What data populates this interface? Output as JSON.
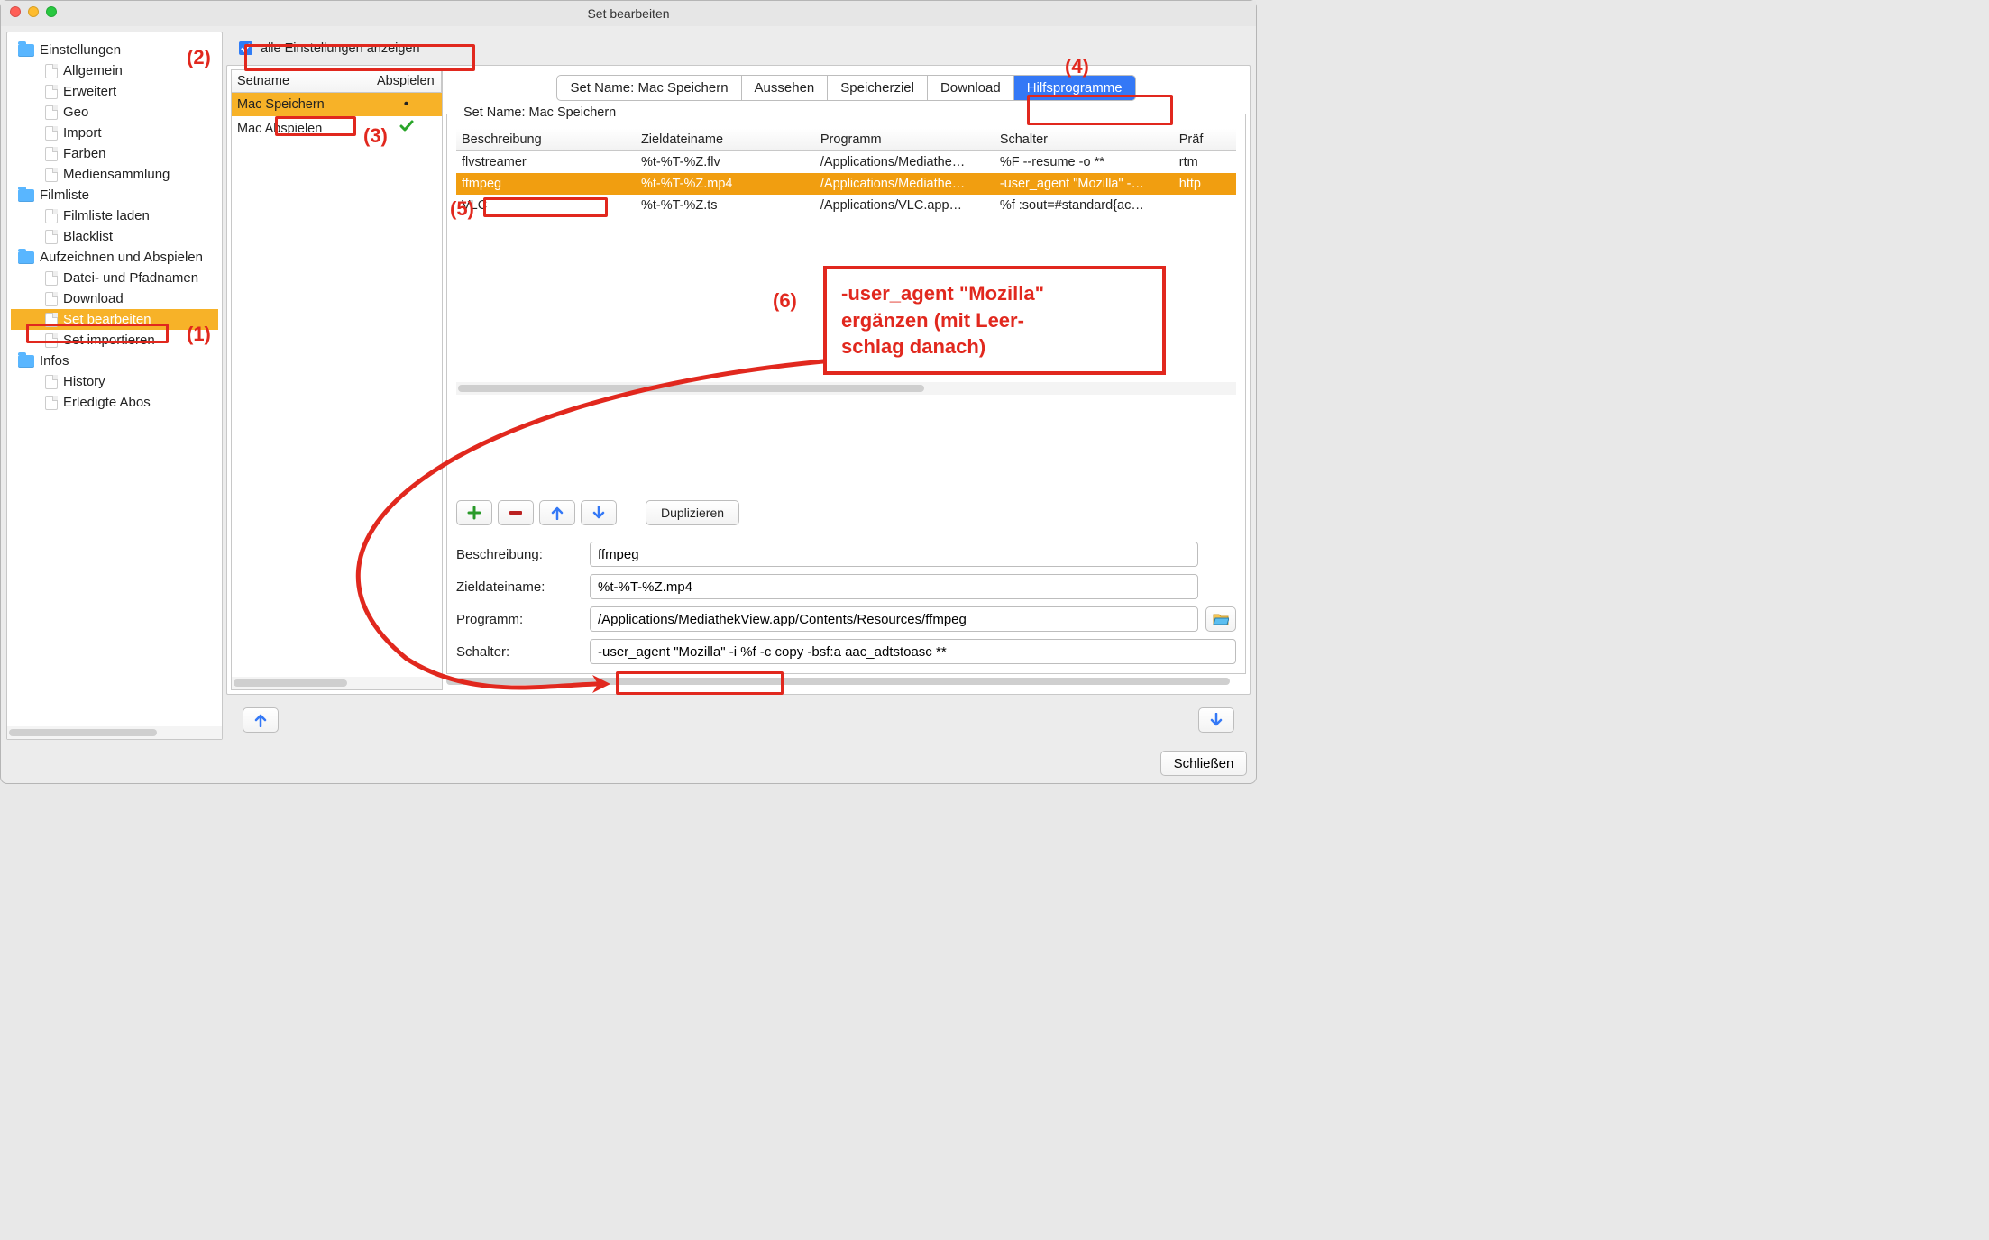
{
  "title": "Set bearbeiten",
  "sidebar": {
    "groups": [
      {
        "label": "Einstellungen",
        "items": [
          {
            "label": "Allgemein"
          },
          {
            "label": "Erweitert"
          },
          {
            "label": "Geo"
          },
          {
            "label": "Import"
          },
          {
            "label": "Farben"
          },
          {
            "label": "Mediensammlung"
          }
        ]
      },
      {
        "label": "Filmliste",
        "items": [
          {
            "label": "Filmliste laden"
          },
          {
            "label": "Blacklist"
          }
        ]
      },
      {
        "label": "Aufzeichnen und Abspielen",
        "items": [
          {
            "label": "Datei- und Pfadnamen"
          },
          {
            "label": "Download"
          },
          {
            "label": "Set bearbeiten",
            "selected": true
          },
          {
            "label": "Set importieren"
          }
        ]
      },
      {
        "label": "Infos",
        "items": [
          {
            "label": "History"
          },
          {
            "label": "Erledigte Abos"
          }
        ]
      }
    ]
  },
  "show_all": {
    "label": "alle Einstellungen anzeigen",
    "checked": true
  },
  "sets": {
    "headers": [
      "Setname",
      "Abspielen"
    ],
    "rows": [
      {
        "name": "Mac Speichern",
        "play": "•",
        "selected": true
      },
      {
        "name": "Mac Abspielen",
        "play": "check"
      }
    ]
  },
  "tabs": [
    {
      "label": "Set Name: Mac Speichern"
    },
    {
      "label": "Aussehen"
    },
    {
      "label": "Speicherziel"
    },
    {
      "label": "Download"
    },
    {
      "label": "Hilfsprogramme",
      "active": true
    }
  ],
  "progs_panel_title": "Set Name: Mac Speichern",
  "progs": {
    "headers": [
      "Beschreibung",
      "Zieldateiname",
      "Programm",
      "Schalter",
      "Präf"
    ],
    "rows": [
      {
        "cells": [
          "flvstreamer",
          "%t-%T-%Z.flv",
          "/Applications/Mediathe…",
          "%F --resume -o **",
          "rtm"
        ]
      },
      {
        "cells": [
          "ffmpeg",
          "%t-%T-%Z.mp4",
          "/Applications/Mediathe…",
          "-user_agent \"Mozilla\" -…",
          "http"
        ],
        "selected": true
      },
      {
        "cells": [
          "VLC",
          "%t-%T-%Z.ts",
          "/Applications/VLC.app…",
          "%f :sout=#standard{ac…",
          ""
        ]
      }
    ]
  },
  "toolbar": {
    "dup": "Duplizieren"
  },
  "form": {
    "beschreibung": {
      "label": "Beschreibung:",
      "value": "ffmpeg"
    },
    "zieldateiname": {
      "label": "Zieldateiname:",
      "value": "%t-%T-%Z.mp4"
    },
    "programm": {
      "label": "Programm:",
      "value": "/Applications/MediathekView.app/Contents/Resources/ffmpeg"
    },
    "schalter": {
      "label": "Schalter:",
      "value": "-user_agent \"Mozilla\" -i %f -c copy -bsf:a aac_adtstoasc **"
    }
  },
  "footer": {
    "close": "Schließen"
  },
  "annotations": {
    "n1": "(1)",
    "n2": "(2)",
    "n3": "(3)",
    "n4": "(4)",
    "n5": "(5)",
    "n6": "(6)",
    "callout_lines": [
      "-user_agent \"Mozilla\"",
      "ergänzen (mit Leer-",
      "schlag danach)"
    ]
  }
}
